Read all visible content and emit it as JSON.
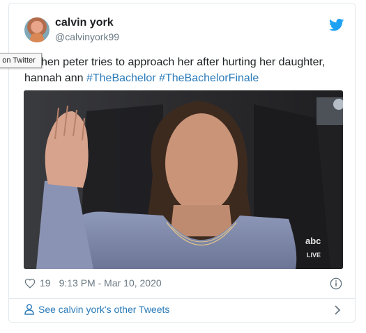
{
  "tooltip": {
    "text": "ge on Twitter"
  },
  "author": {
    "name": "calvin york",
    "handle": "@calvinyork99"
  },
  "tweet": {
    "prefix": "i: when peter tries to approach her after hurting her daughter, hannah ann ",
    "hashtags": [
      "#TheBachelor",
      "#TheBachelorFinale"
    ]
  },
  "media": {
    "watermark_line1": "abc",
    "watermark_line2": "LIVE"
  },
  "footer": {
    "like_count": "19",
    "timestamp": "9:13 PM - Mar 10, 2020",
    "other_tweets_label": "See calvin york's other Tweets"
  },
  "colors": {
    "accent": "#2b7bb9",
    "twitter_blue": "#1da1f2",
    "muted": "#697882"
  },
  "icons": [
    "twitter-bird-icon",
    "heart-icon",
    "info-icon",
    "person-icon",
    "chevron-right-icon"
  ]
}
